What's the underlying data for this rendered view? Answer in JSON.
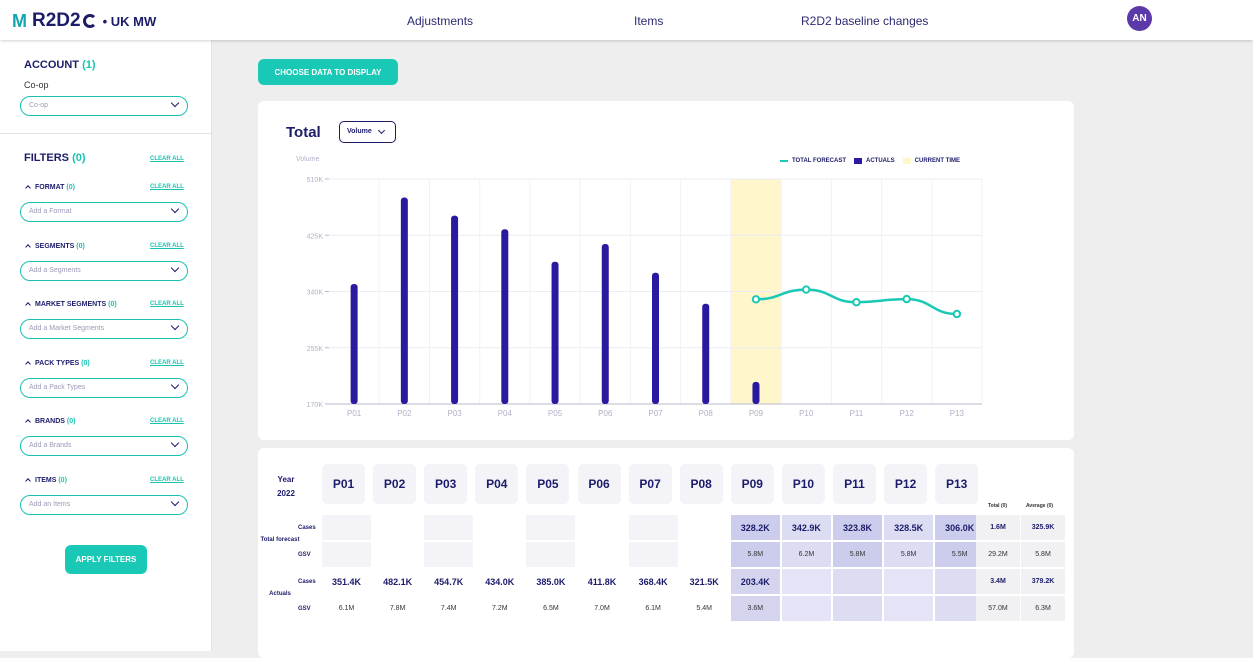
{
  "app": {
    "logo_mark": "M",
    "name": "R2D2",
    "region": "• UK MW"
  },
  "nav": [
    {
      "label": "Adjustments"
    },
    {
      "label": "Items"
    },
    {
      "label": "R2D2 baseline changes"
    }
  ],
  "user": {
    "initials": "AN"
  },
  "sidebar": {
    "account": {
      "title": "ACCOUNT",
      "count": "(1)",
      "value": "Co-op",
      "select_value": "Co-op"
    },
    "filters": {
      "title": "FILTERS",
      "count": "(0)",
      "clear_all": "CLEAR ALL"
    },
    "groups": [
      {
        "label": "FORMAT",
        "count": "(0)",
        "clear": "CLEAR ALL",
        "placeholder": "Add a Format"
      },
      {
        "label": "SEGMENTS",
        "count": "(0)",
        "clear": "CLEAR ALL",
        "placeholder": "Add a Segments"
      },
      {
        "label": "MARKET SEGMENTS",
        "count": "(0)",
        "clear": "CLEAR ALL",
        "placeholder": "Add a Market Segments"
      },
      {
        "label": "PACK TYPES",
        "count": "(0)",
        "clear": "CLEAR ALL",
        "placeholder": "Add a Pack Types"
      },
      {
        "label": "BRANDS",
        "count": "(0)",
        "clear": "CLEAR ALL",
        "placeholder": "Add a Brands"
      },
      {
        "label": "ITEMS",
        "count": "(0)",
        "clear": "CLEAR ALL",
        "placeholder": "Add an Items"
      }
    ],
    "apply_label": "APPLY FILTERS"
  },
  "main": {
    "choose_label": "CHOOSE DATA TO DISPLAY",
    "chart_title": "Total",
    "metric_select": "Volume",
    "legend": {
      "forecast": "TOTAL FORECAST",
      "actuals": "ACTUALS",
      "current": "CURRENT TIME"
    }
  },
  "chart_data": {
    "type": "bar",
    "ylabel": "Volume",
    "ylim": [
      170000,
      510000
    ],
    "yticks": [
      170000,
      255000,
      340000,
      425000,
      510000
    ],
    "ytick_labels": [
      "170K",
      "255K",
      "340K",
      "425K",
      "510K"
    ],
    "categories": [
      "P01",
      "P02",
      "P03",
      "P04",
      "P05",
      "P06",
      "P07",
      "P08",
      "P09",
      "P10",
      "P11",
      "P12",
      "P13"
    ],
    "series": [
      {
        "name": "ACTUALS",
        "kind": "bar",
        "values": [
          351400,
          482100,
          454700,
          434000,
          385000,
          411800,
          368400,
          321500,
          203400,
          null,
          null,
          null,
          null
        ]
      },
      {
        "name": "TOTAL FORECAST",
        "kind": "line",
        "values": [
          null,
          null,
          null,
          null,
          null,
          null,
          null,
          null,
          328200,
          342900,
          323800,
          328500,
          306000
        ]
      }
    ],
    "current_time_period": "P09",
    "grid": true,
    "legend_position": "top-right"
  },
  "table": {
    "year_label": "Year",
    "year": "2022",
    "periods": [
      "P01",
      "P02",
      "P03",
      "P04",
      "P05",
      "P06",
      "P07",
      "P08",
      "P09",
      "P10",
      "P11",
      "P12",
      "P13"
    ],
    "total_header": "Total (0)",
    "average_header": "Average (0)",
    "sections": [
      {
        "label": "Total forecast",
        "rows": [
          {
            "label": "Cases",
            "values": [
              "",
              "",
              "",
              "",
              "",
              "",
              "",
              "",
              "328.2K",
              "342.9K",
              "323.8K",
              "328.5K",
              "306.0K"
            ],
            "total": "1.6M",
            "average": "325.9K"
          },
          {
            "label": "GSV",
            "values": [
              "",
              "",
              "",
              "",
              "",
              "",
              "",
              "",
              "5.8M",
              "6.2M",
              "5.8M",
              "5.8M",
              "5.5M"
            ],
            "total": "29.2M",
            "average": "5.8M"
          }
        ]
      },
      {
        "label": "Actuals",
        "rows": [
          {
            "label": "Cases",
            "values": [
              "351.4K",
              "482.1K",
              "454.7K",
              "434.0K",
              "385.0K",
              "411.8K",
              "368.4K",
              "321.5K",
              "203.4K",
              "",
              "",
              "",
              ""
            ],
            "total": "3.4M",
            "average": "379.2K"
          },
          {
            "label": "GSV",
            "values": [
              "6.1M",
              "7.8M",
              "7.4M",
              "7.2M",
              "6.5M",
              "7.0M",
              "6.1M",
              "5.4M",
              "3.6M",
              "",
              "",
              "",
              ""
            ],
            "total": "57.0M",
            "average": "6.3M"
          }
        ]
      }
    ]
  },
  "colors": {
    "accent": "#19c9b5",
    "brand": "#1c1c6b",
    "bar": "#2a1aa0",
    "current": "#fff6cc",
    "forecast_cell": "#dcdcf0"
  }
}
